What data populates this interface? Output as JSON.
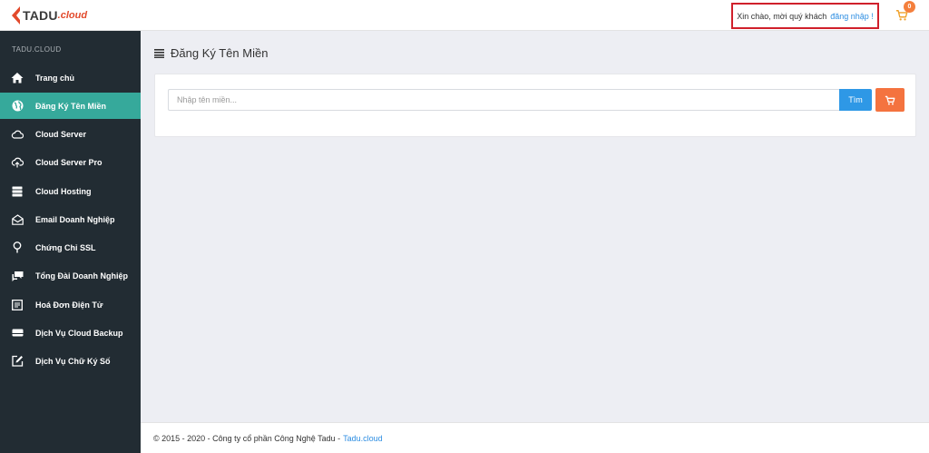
{
  "brand": {
    "name": "TADU",
    "suffix": ".cloud",
    "color": "#e24a2c"
  },
  "header": {
    "greeting": "Xin chào, mời quý khách",
    "login_label": "đăng nhập !",
    "cart_count": "0"
  },
  "sidebar": {
    "title": "TADU.CLOUD",
    "items": [
      {
        "label": "Trang chủ",
        "icon": "home-icon",
        "active": false
      },
      {
        "label": "Đăng Ký Tên Miền",
        "icon": "globe-icon",
        "active": true
      },
      {
        "label": "Cloud Server",
        "icon": "cloud-icon",
        "active": false
      },
      {
        "label": "Cloud Server Pro",
        "icon": "cloud-upload-icon",
        "active": false
      },
      {
        "label": "Cloud Hosting",
        "icon": "server-stack-icon",
        "active": false
      },
      {
        "label": "Email Doanh Nghiệp",
        "icon": "envelope-open-icon",
        "active": false
      },
      {
        "label": "Chứng Chỉ SSL",
        "icon": "bulb-icon",
        "active": false
      },
      {
        "label": "Tổng Đài Doanh Nghiệp",
        "icon": "chat-icon",
        "active": false
      },
      {
        "label": "Hoá Đơn Điện Tử",
        "icon": "document-icon",
        "active": false
      },
      {
        "label": "Dịch Vụ Cloud Backup",
        "icon": "drive-icon",
        "active": false
      },
      {
        "label": "Dịch Vụ Chữ Ký Số",
        "icon": "edit-icon",
        "active": false
      }
    ]
  },
  "main": {
    "title": "Đăng Ký Tên Miền",
    "search": {
      "placeholder": "Nhập tên miền...",
      "value": "",
      "button_label": "Tìm"
    }
  },
  "footer": {
    "text": "© 2015 - 2020 - Công ty cổ phần Công Nghệ Tadu -",
    "link": "Tadu.cloud"
  },
  "colors": {
    "sidebar_bg": "#222c33",
    "active_bg": "#36a99b",
    "primary": "#2e98e6",
    "cart": "#f4733f",
    "highlight": "#d0202b"
  }
}
